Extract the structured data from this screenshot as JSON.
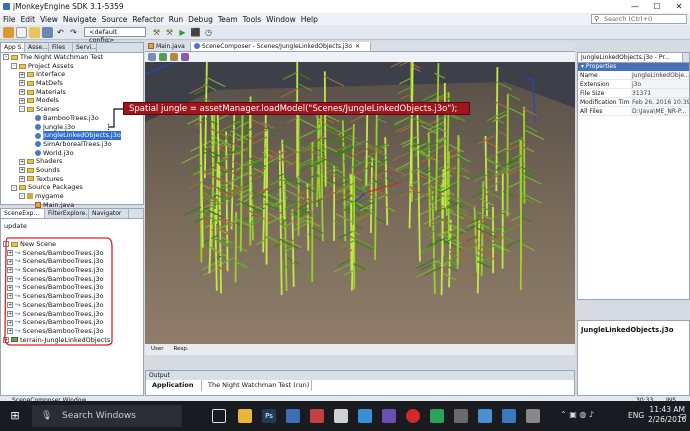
{
  "window": {
    "title": "jMonkeyEngine SDK 3.1-5359"
  },
  "menu": {
    "items": [
      "File",
      "Edit",
      "View",
      "Navigate",
      "Source",
      "Refactor",
      "Run",
      "Debug",
      "Team",
      "Tools",
      "Window",
      "Help"
    ]
  },
  "search": {
    "placeholder": "Search (Ctrl+I)"
  },
  "toolbar": {
    "config": "<default config>"
  },
  "project_tabs": [
    "App S...",
    "Asse...",
    "Files",
    "Servi..."
  ],
  "project_tree": [
    {
      "label": "The Night Watchman Test",
      "level": 0,
      "toggle": "-",
      "icon": "fold"
    },
    {
      "label": "Project Assets",
      "level": 1,
      "toggle": "-",
      "icon": "fold"
    },
    {
      "label": "Interface",
      "level": 2,
      "toggle": "+",
      "icon": "fold"
    },
    {
      "label": "MatDefs",
      "level": 2,
      "toggle": "+",
      "icon": "fold"
    },
    {
      "label": "Materials",
      "level": 2,
      "toggle": "+",
      "icon": "fold"
    },
    {
      "label": "Models",
      "level": 2,
      "toggle": "+",
      "icon": "fold"
    },
    {
      "label": "Scenes",
      "level": 2,
      "toggle": "-",
      "icon": "fold"
    },
    {
      "label": "BambooTrees.j3o",
      "level": 3,
      "icon": "j3o"
    },
    {
      "label": "Jungle.j3o",
      "level": 3,
      "icon": "j3o"
    },
    {
      "label": "JungleLinkedObjects.j3o",
      "level": 3,
      "icon": "j3o",
      "selected": true
    },
    {
      "label": "SimArborealTrees.j3o",
      "level": 3,
      "icon": "j3o"
    },
    {
      "label": "World.j3o",
      "level": 3,
      "icon": "j3o"
    },
    {
      "label": "Shaders",
      "level": 2,
      "toggle": "+",
      "icon": "fold"
    },
    {
      "label": "Sounds",
      "level": 2,
      "toggle": "+",
      "icon": "fold"
    },
    {
      "label": "Textures",
      "level": 2,
      "toggle": "+",
      "icon": "fold"
    },
    {
      "label": "Source Packages",
      "level": 1,
      "toggle": "-",
      "icon": "fold"
    },
    {
      "label": "mygame",
      "level": 2,
      "toggle": "-",
      "icon": "pkg"
    },
    {
      "label": "Main.java",
      "level": 3,
      "icon": "java"
    }
  ],
  "scene_tabs": [
    "SceneExp...",
    "FilterExplore...",
    "Navigator"
  ],
  "scene_update": "update",
  "scene_tree": {
    "root": "New Scene",
    "items": [
      "Scenes/BambooTrees.j3o",
      "Scenes/BambooTrees.j3o",
      "Scenes/BambooTrees.j3o",
      "Scenes/BambooTrees.j3o",
      "Scenes/BambooTrees.j3o",
      "Scenes/BambooTrees.j3o",
      "Scenes/BambooTrees.j3o",
      "Scenes/BambooTrees.j3o",
      "Scenes/BambooTrees.j3o",
      "Scenes/BambooTrees.j3o"
    ],
    "terrain": "terrain-JungleLinkedObjects"
  },
  "editor_tabs": [
    "Main.java",
    "SceneComposer - Scenes/JungleLinkedObjects.j3o"
  ],
  "annotation": "Spatial jungle = assetManager.loadModel(\"Scenes/JungleLinkedObjects.j3o\");",
  "viewport_footer": [
    "User",
    "Resp."
  ],
  "props": {
    "tab": "JungleLinkedObjects.j3o - Pr...",
    "header": "Properties",
    "rows": [
      [
        "Name",
        "JungleLinkedObje..."
      ],
      [
        "Extension",
        "j3o"
      ],
      [
        "File Size",
        "31371"
      ],
      [
        "Modification Time",
        "Feb 26, 2016 10:39..."
      ],
      [
        "All Files",
        "D:\\Java\\ME_NR-P..."
      ]
    ],
    "footer": "JungleLinkedObjects.j3o"
  },
  "output": {
    "label": "Output",
    "tabs": [
      "Application",
      "The Night Watchman Test (run)"
    ]
  },
  "status": {
    "left": "SceneComposer Window",
    "pos": "30:33",
    "mode": "INS"
  },
  "taskbar": {
    "search": "Search Windows",
    "lang": "ENG",
    "time": "11:43 AM",
    "date": "2/26/2016"
  },
  "colors": {
    "annotation": "#a0151b",
    "selection": "#2f6fd1",
    "highlight_circle": "#e0202a"
  }
}
